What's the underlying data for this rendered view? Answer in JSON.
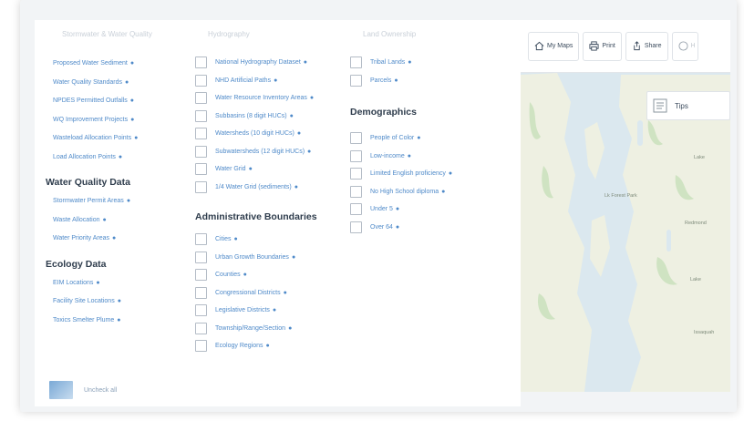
{
  "left_col": {
    "faded_header": "Stormwater & Water Quality",
    "items_top": [
      "Proposed Water Sediment",
      "Water Quality Standards",
      "NPDES Permitted Outfalls",
      "WQ Improvement Projects",
      "Wasteload Allocation Points",
      "Load Allocation Points"
    ],
    "section_2": "Water Quality Data",
    "items_mid": [
      "Stormwater Permit Areas",
      "Waste Allocation",
      "Water Priority Areas"
    ],
    "section_3": "Ecology Data",
    "items_bottom": [
      "EIM Locations",
      "Facility Site Locations",
      "Toxics Smelter Plume"
    ]
  },
  "mid_col": {
    "faded_header": "Hydrography",
    "items_top": [
      "National Hydrography Dataset",
      "NHD Artificial Paths",
      "Water Resource Inventory Areas",
      "Subbasins (8 digit HUCs)",
      "Watersheds (10 digit HUCs)",
      "Subwatersheds (12 digit HUCs)",
      "Water Grid",
      "1/4 Water Grid (sediments)"
    ],
    "section_2": "Administrative Boundaries",
    "items_bottom": [
      "Cities",
      "Urban Growth Boundaries",
      "Counties",
      "Congressional Districts",
      "Legislative Districts",
      "Township/Range/Section",
      "Ecology Regions"
    ]
  },
  "right_col": {
    "faded_header": "Land Ownership",
    "items_top": [
      "Tribal Lands",
      "Parcels"
    ],
    "section_2": "Demographics",
    "items_bottom": [
      "People of Color",
      "Low-income",
      "Limited English proficiency",
      "No High School diploma",
      "Under 5",
      "Over 64"
    ]
  },
  "info_glyph": "●",
  "bottom_bar": {
    "uncheck_label": "Uncheck all"
  },
  "map": {
    "toolbar": {
      "my_maps": "My Maps",
      "print": "Print",
      "share": "Share",
      "help": "H"
    },
    "tips_label": "Tips",
    "labels": {
      "lake_forest": "Lk Forest Park",
      "redmond": "Redmond",
      "lake": "Lake",
      "lake_2": "Lake",
      "issaquah": "Issaquah"
    }
  },
  "colors": {
    "link": "#4f8ac9",
    "heading": "#2f3d4d",
    "map_water": "#dbe8ef",
    "map_land": "#eef0e2",
    "map_green": "#cfe3c2"
  }
}
